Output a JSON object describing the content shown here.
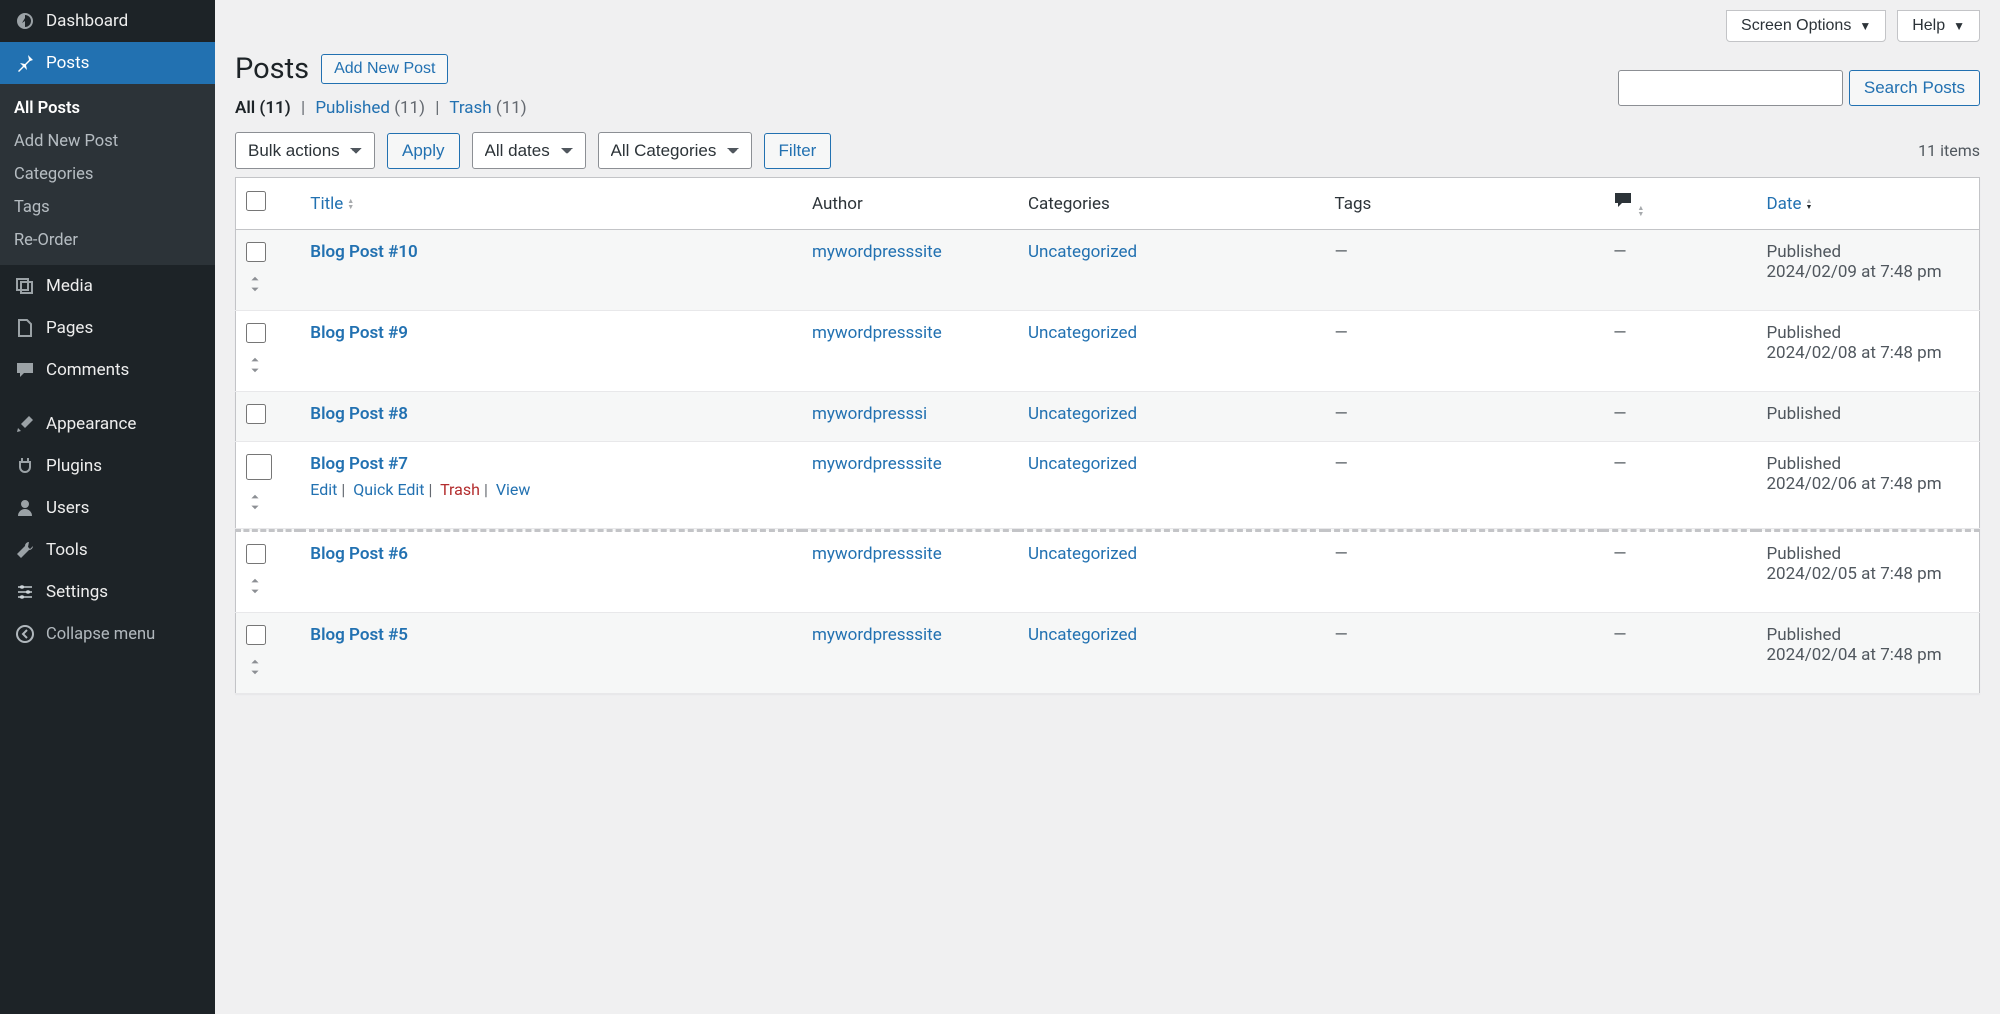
{
  "topbar": {
    "screen_options": "Screen Options",
    "help": "Help"
  },
  "sidebar": {
    "items": [
      {
        "label": "Dashboard"
      },
      {
        "label": "Posts"
      },
      {
        "label": "Media"
      },
      {
        "label": "Pages"
      },
      {
        "label": "Comments"
      },
      {
        "label": "Appearance"
      },
      {
        "label": "Plugins"
      },
      {
        "label": "Users"
      },
      {
        "label": "Tools"
      },
      {
        "label": "Settings"
      }
    ],
    "submenu": [
      {
        "label": "All Posts"
      },
      {
        "label": "Add New Post"
      },
      {
        "label": "Categories"
      },
      {
        "label": "Tags"
      },
      {
        "label": "Re-Order"
      }
    ],
    "collapse": "Collapse menu"
  },
  "header": {
    "title": "Posts",
    "add_new": "Add New Post"
  },
  "views": {
    "all": "All",
    "all_count": "(11)",
    "published": "Published",
    "published_count": "(11)",
    "trash": "Trash",
    "trash_count": "(11)"
  },
  "search": {
    "placeholder": "",
    "button": "Search Posts"
  },
  "bulk": {
    "placeholder": "Bulk actions",
    "apply": "Apply"
  },
  "filters": {
    "dates": "All dates",
    "categories": "All Categories",
    "filter": "Filter"
  },
  "pagination": {
    "items": "11 items"
  },
  "columns": {
    "title": "Title",
    "author": "Author",
    "categories": "Categories",
    "tags": "Tags",
    "date": "Date"
  },
  "row_actions": {
    "edit": "Edit",
    "quick_edit": "Quick Edit",
    "trash": "Trash",
    "view": "View"
  },
  "rows": [
    {
      "title": "Blog Post #10",
      "author": "mywordpresssite",
      "categories": "Uncategorized",
      "tags": "—",
      "comments": "—",
      "status": "Published",
      "date": "2024/02/09 at 7:48 pm",
      "show_date": true,
      "show_reorder": true
    },
    {
      "title": "Blog Post #9",
      "author": "mywordpresssite",
      "categories": "Uncategorized",
      "tags": "—",
      "comments": "—",
      "status": "Published",
      "date": "2024/02/08 at 7:48 pm",
      "show_date": true,
      "show_reorder": true
    },
    {
      "title": "Blog Post #8",
      "author": "mywordpresssi",
      "categories": "Uncategorized",
      "tags": "—",
      "comments": "—",
      "status": "Published",
      "date": "",
      "show_date": false,
      "show_reorder": false
    },
    {
      "title": "Blog Post #7",
      "author": "mywordpresssite",
      "categories": "Uncategorized",
      "tags": "—",
      "comments": "—",
      "status": "Published",
      "date": "2024/02/06 at 7:48 pm",
      "show_date": true,
      "show_reorder": true,
      "hovered": true
    },
    {
      "title": "Blog Post #6",
      "author": "mywordpresssite",
      "categories": "Uncategorized",
      "tags": "—",
      "comments": "—",
      "status": "Published",
      "date": "2024/02/05 at 7:48 pm",
      "show_date": true,
      "show_reorder": true
    },
    {
      "title": "Blog Post #5",
      "author": "mywordpresssite",
      "categories": "Uncategorized",
      "tags": "—",
      "comments": "—",
      "status": "Published",
      "date": "2024/02/04 at 7:48 pm",
      "show_date": true,
      "show_reorder": true
    }
  ]
}
